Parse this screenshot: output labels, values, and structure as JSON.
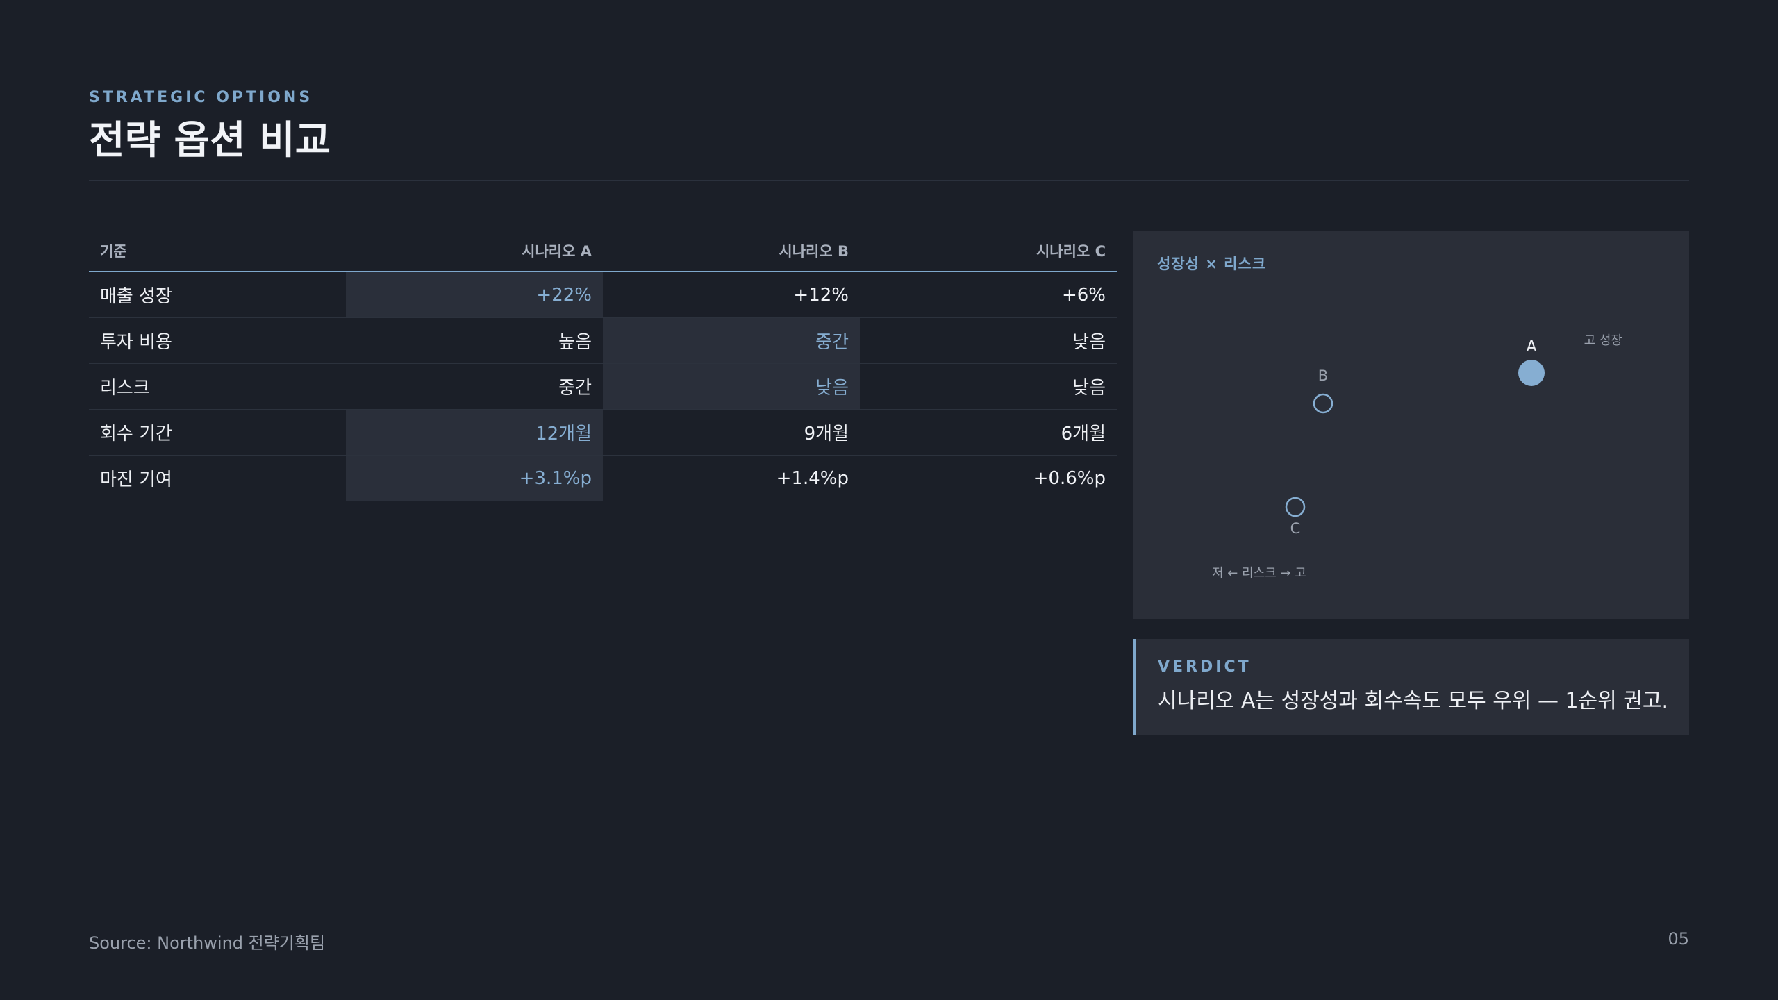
{
  "header": {
    "eyebrow": "STRATEGIC OPTIONS",
    "title": "전략 옵션 비교"
  },
  "table": {
    "columns": [
      "기준",
      "시나리오 A",
      "시나리오 B",
      "시나리오 C"
    ],
    "rows": [
      {
        "label": "매출 성장",
        "values": [
          "+22%",
          "+12%",
          "+6%"
        ],
        "highlight": 0
      },
      {
        "label": "투자 비용",
        "values": [
          "높음",
          "중간",
          "낮음"
        ],
        "highlight": 1
      },
      {
        "label": "리스크",
        "values": [
          "중간",
          "낮음",
          "낮음"
        ],
        "highlight": 1
      },
      {
        "label": "회수 기간",
        "values": [
          "12개월",
          "9개월",
          "6개월"
        ],
        "highlight": 0
      },
      {
        "label": "마진 기여",
        "values": [
          "+3.1%p",
          "+1.4%p",
          "+0.6%p"
        ],
        "highlight": 0
      }
    ]
  },
  "chart": {
    "title": "성장성 × 리스크",
    "x_axis_label": "저 ← 리스크 → 고",
    "y_axis_label": "고 성장",
    "accent": "#86aed2"
  },
  "verdict": {
    "label": "VERDICT",
    "text": "시나리오 A는 성장성과 회수속도 모두 우위 — 1순위 권고."
  },
  "footer": {
    "source": "Source: Northwind 전략기획팀",
    "page": "05"
  }
}
